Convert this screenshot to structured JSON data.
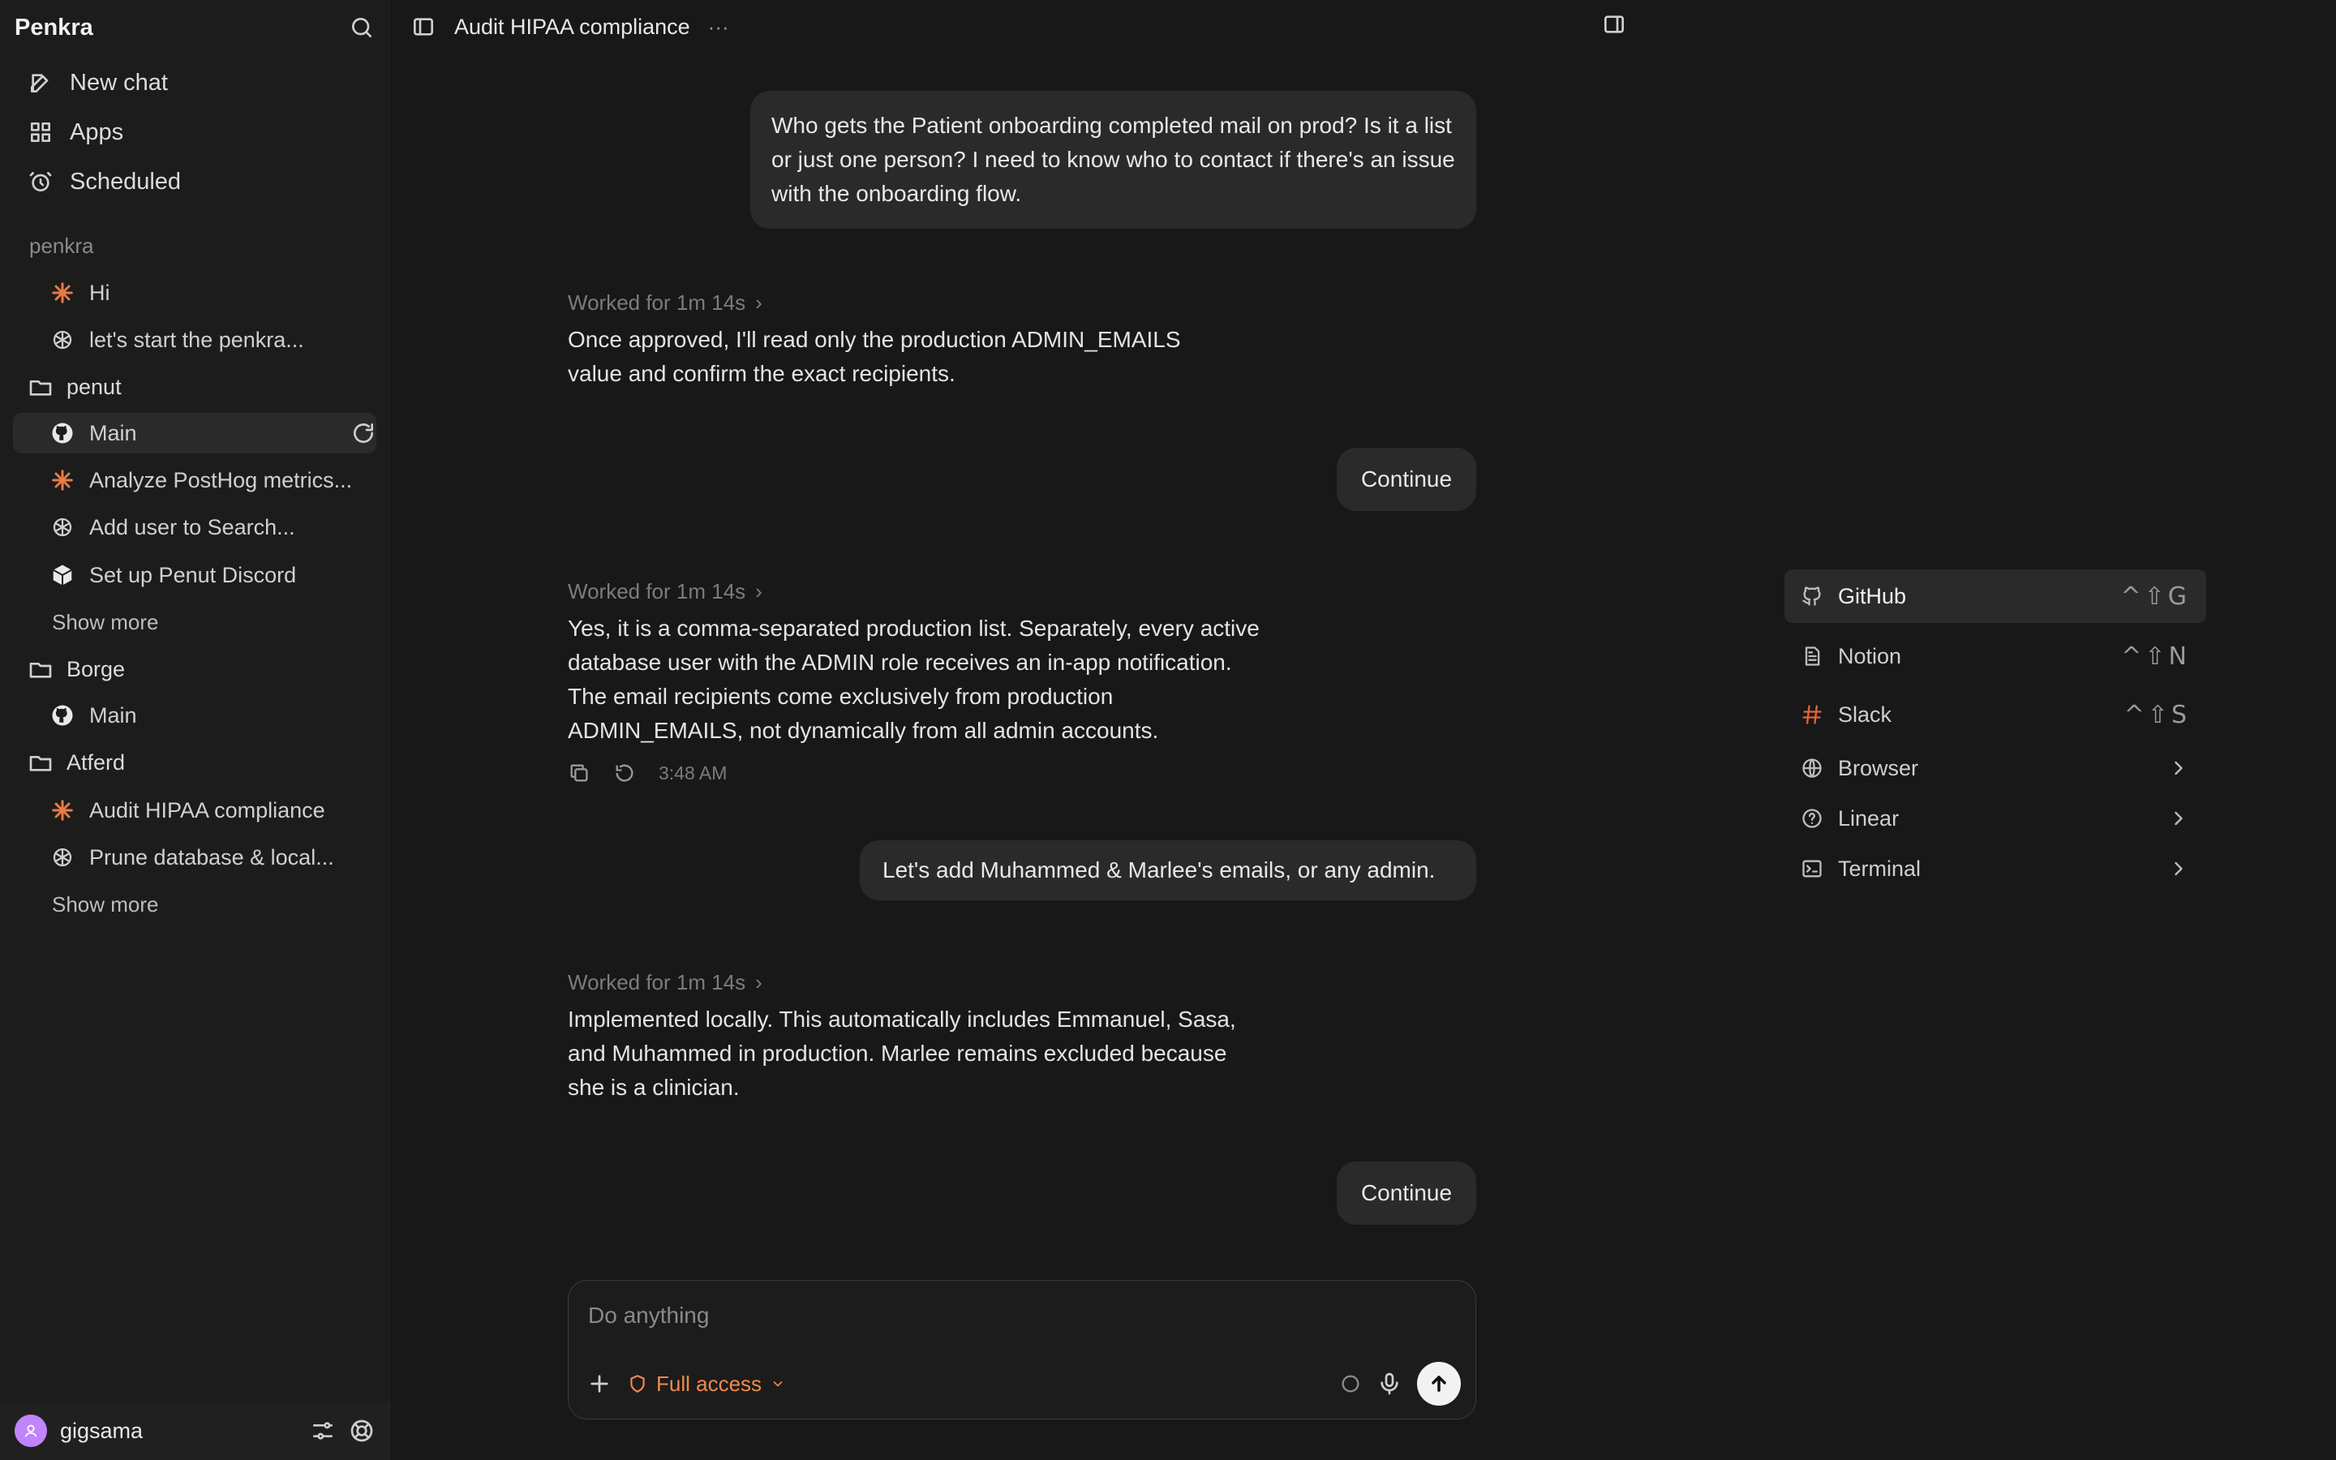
{
  "sidebar": {
    "brand": "Penkra",
    "nav": [
      {
        "label": "New chat",
        "icon": "compose-icon"
      },
      {
        "label": "Apps",
        "icon": "grid-icon"
      },
      {
        "label": "Scheduled",
        "icon": "alarm-icon"
      }
    ],
    "section_label": "penkra",
    "penkra_threads": [
      {
        "label": "Hi",
        "icon": "spark-icon"
      },
      {
        "label": "let's start the penkra...",
        "icon": "openai-icon"
      }
    ],
    "folders": [
      {
        "name": "penut",
        "threads": [
          {
            "label": "Main",
            "icon": "github-icon"
          },
          {
            "label": "Analyze PostHog metrics...",
            "icon": "spark-icon"
          },
          {
            "label": "Add user to Search...",
            "icon": "openai-icon"
          },
          {
            "label": "Set up Penut Discord",
            "icon": "cube-icon"
          }
        ],
        "show_more": "Show more"
      },
      {
        "name": "Borge",
        "threads": [
          {
            "label": "Main",
            "icon": "github-icon"
          }
        ]
      },
      {
        "name": "Atferd",
        "threads": [
          {
            "label": "Audit HIPAA compliance",
            "icon": "spark-icon"
          },
          {
            "label": "Prune database & local...",
            "icon": "openai-icon"
          }
        ],
        "show_more": "Show more"
      }
    ],
    "user": {
      "name": "gigsama"
    }
  },
  "topbar": {
    "title": "Audit HIPAA compliance",
    "more": "···"
  },
  "messages": [
    {
      "role": "user",
      "text": "Who gets the Patient onboarding completed mail on prod? Is it a list or just one person? I need to know who to contact if there's an issue with the onboarding flow."
    },
    {
      "role": "assistant",
      "worked": "Worked for 1m 14s",
      "text": "Once approved, I'll read only the production ADMIN_EMAILS value and confirm the exact recipients."
    },
    {
      "role": "user",
      "text": "Continue"
    },
    {
      "role": "assistant",
      "worked": "Worked for 1m 14s",
      "text": "Yes, it is a comma-separated production list. Separately, every active database user with the ADMIN role receives an in-app notification. The email recipients come exclusively from production ADMIN_EMAILS, not dynamically from all admin accounts.",
      "time": "3:48 AM"
    },
    {
      "role": "user",
      "text": "Let's add Muhammed & Marlee's emails, or any admin."
    },
    {
      "role": "assistant",
      "worked": "Worked for 1m 14s",
      "text": "Implemented locally. This automatically includes Emmanuel, Sasa, and Muhammed in production. Marlee remains excluded because she is a clinician."
    },
    {
      "role": "user",
      "text": "Continue"
    }
  ],
  "composer": {
    "placeholder": "Do anything",
    "access_label": "Full access"
  },
  "menu": [
    {
      "label": "GitHub",
      "shortcut": "^⇧G",
      "icon": "github-icon"
    },
    {
      "label": "Notion",
      "shortcut": "^⇧N",
      "icon": "document-icon"
    },
    {
      "label": "Slack",
      "shortcut": "^⇧S",
      "icon": "hash-icon"
    },
    {
      "label": "Browser",
      "shortcut": "",
      "icon": "globe-icon"
    },
    {
      "label": "Linear",
      "shortcut": "",
      "icon": "help-circle-icon"
    },
    {
      "label": "Terminal",
      "shortcut": "",
      "icon": "terminal-icon"
    }
  ],
  "colors": {
    "accent": "#f08a4b",
    "background": "#181818",
    "sidebar": "#1c1c1c",
    "bubble": "#2a2a2a"
  }
}
